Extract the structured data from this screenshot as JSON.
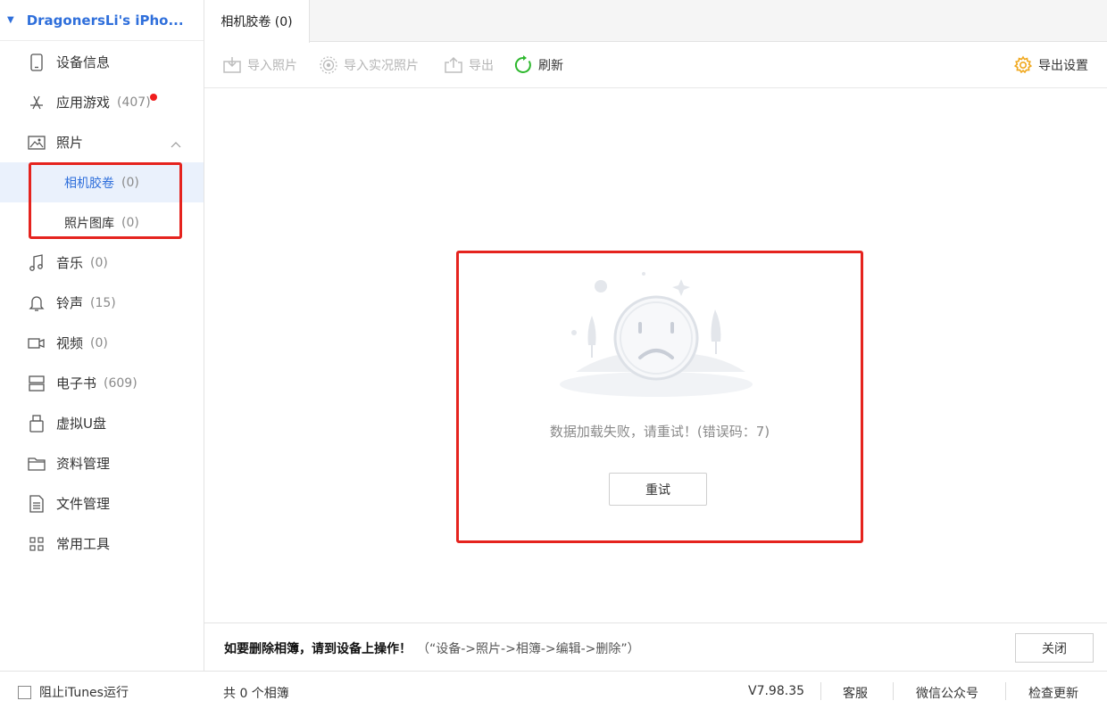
{
  "device": {
    "name": "DragonersLi's iPho..."
  },
  "sidebar": {
    "items": [
      {
        "label": "设备信息",
        "count": "",
        "icon": "phone-icon"
      },
      {
        "label": "应用游戏",
        "count": "(407)",
        "icon": "app-store-icon"
      },
      {
        "label": "照片",
        "count": "",
        "icon": "image-icon"
      },
      {
        "label": "相机胶卷",
        "count": "(0)",
        "icon": ""
      },
      {
        "label": "照片图库",
        "count": "(0)",
        "icon": ""
      },
      {
        "label": "音乐",
        "count": "(0)",
        "icon": "music-icon"
      },
      {
        "label": "铃声",
        "count": "(15)",
        "icon": "bell-icon"
      },
      {
        "label": "视频",
        "count": "(0)",
        "icon": "video-icon"
      },
      {
        "label": "电子书",
        "count": "(609)",
        "icon": "book-icon"
      },
      {
        "label": "虚拟U盘",
        "count": "",
        "icon": "usb-drive-icon"
      },
      {
        "label": "资料管理",
        "count": "",
        "icon": "folder-icon"
      },
      {
        "label": "文件管理",
        "count": "",
        "icon": "file-icon"
      },
      {
        "label": "常用工具",
        "count": "",
        "icon": "grid-icon"
      }
    ]
  },
  "tabs": [
    {
      "label": "相机胶卷 (0)"
    }
  ],
  "toolbar": {
    "import_photos": "导入照片",
    "import_live_photos": "导入实况照片",
    "export": "导出",
    "refresh": "刷新",
    "export_settings": "导出设置"
  },
  "main": {
    "error_text": "数据加载失败，请重试！(错误码：7)",
    "retry": "重试"
  },
  "infobar": {
    "message": "如要删除相簿，请到设备上操作！",
    "path": "（“设备->照片->相簿->编辑->删除”）",
    "close": "关闭"
  },
  "status": {
    "block_itunes": "阻止iTunes运行",
    "album_count": "共 0 个相簿",
    "version": "V7.98.35",
    "service": "客服",
    "wechat": "微信公众号",
    "check_update": "检查更新"
  },
  "colors": {
    "accent": "#2f6fdb",
    "highlight": "#e5231e",
    "badge": "#f01d1d"
  }
}
